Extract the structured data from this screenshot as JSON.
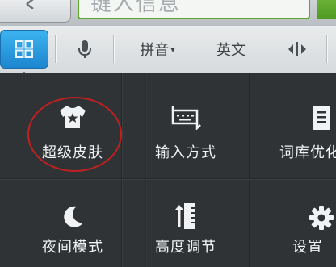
{
  "input": {
    "placeholder": "键入信息"
  },
  "toolbar": {
    "pinyin_label": "拼音",
    "english_label": "英文",
    "caret": "▾"
  },
  "menu": {
    "items": [
      {
        "label": "超级皮肤",
        "icon": "tshirt-star-icon"
      },
      {
        "label": "输入方式",
        "icon": "keyboard-icon"
      },
      {
        "label": "词库优化",
        "icon": "book-icon"
      },
      {
        "label": "夜间模式",
        "icon": "moon-icon"
      },
      {
        "label": "高度调节",
        "icon": "height-adjust-icon"
      },
      {
        "label": "设置",
        "icon": "gear-icon"
      }
    ]
  },
  "colors": {
    "accent_blue": "#2196de",
    "highlight_red": "#c0211f",
    "panel_bg": "#303336",
    "input_border": "#5fa62f"
  }
}
